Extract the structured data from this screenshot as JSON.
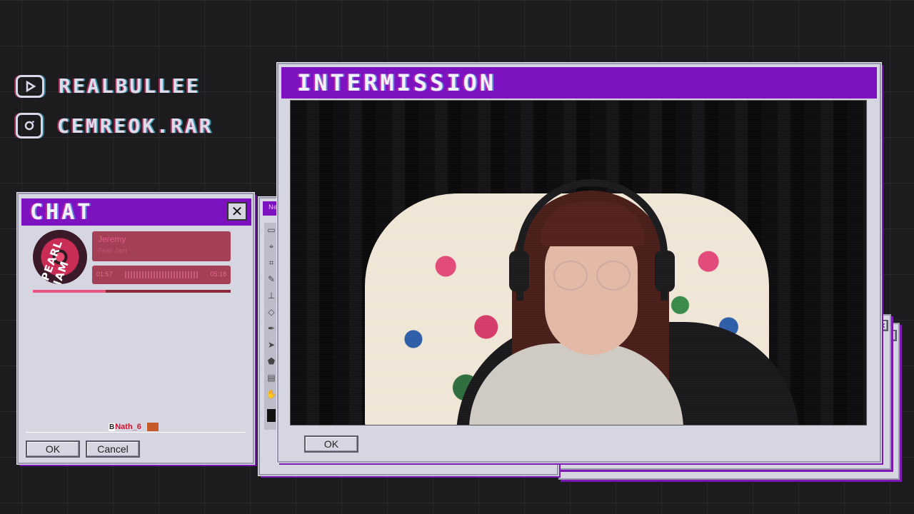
{
  "socials": [
    {
      "platform_icon": "youtube-icon",
      "handle": "REALBULLEE"
    },
    {
      "platform_icon": "instagram-icon",
      "handle": "CEMREOK.RAR"
    }
  ],
  "chat_window": {
    "title": "CHAT",
    "close_glyph": "✕",
    "now_playing": {
      "album_art_text": "PEARL JAM",
      "song_title": "Jeremy",
      "artist": "Pearl Jam",
      "elapsed": "01:57",
      "duration": "05:18",
      "progress_fraction": 0.37
    },
    "messages": [
      {
        "badge": "B",
        "username": "Nath_6"
      }
    ],
    "ok_label": "OK",
    "cancel_label": "Cancel"
  },
  "paint_window": {
    "title_fragment": "Ne"
  },
  "main_window": {
    "title": "INTERMISSION",
    "ok_label": "OK"
  },
  "colors": {
    "accent_purple": "#7d12c0",
    "window_gray": "#d6d5e2",
    "player_pink": "#a34055"
  }
}
